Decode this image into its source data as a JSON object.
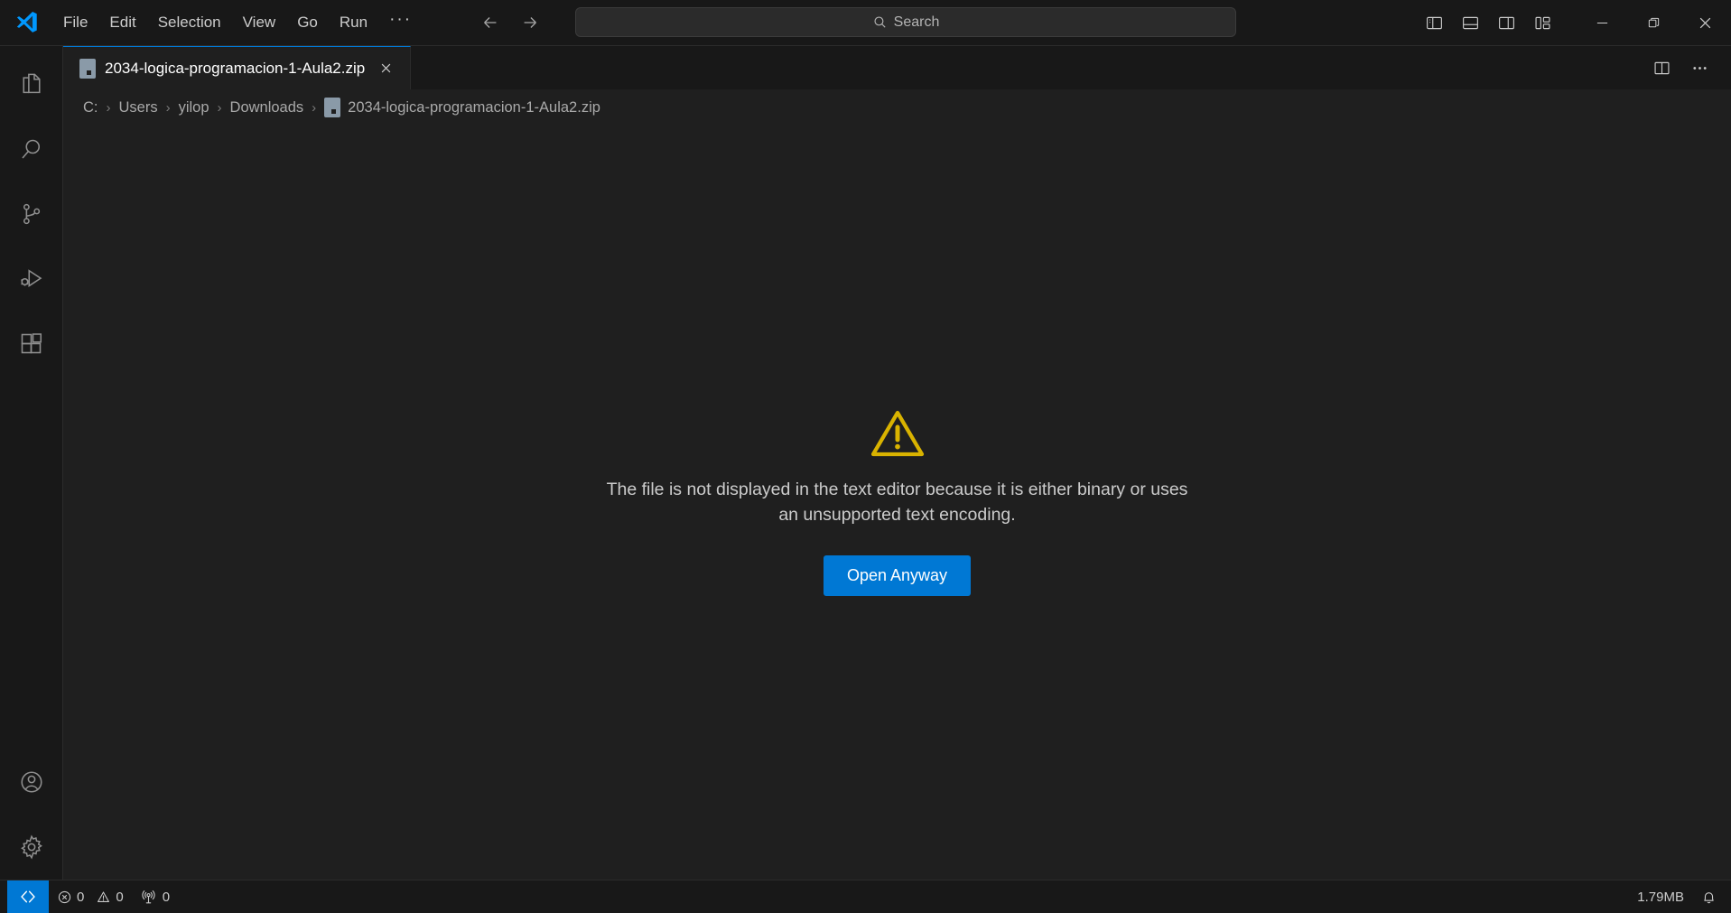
{
  "window": {
    "app_logo": "vscode-logo",
    "menus": [
      {
        "label": "File"
      },
      {
        "label": "Edit"
      },
      {
        "label": "Selection"
      },
      {
        "label": "View"
      },
      {
        "label": "Go"
      },
      {
        "label": "Run"
      }
    ],
    "menu_overflow_label": "···",
    "nav": {
      "back_icon": "arrow-left-icon",
      "forward_icon": "arrow-right-icon"
    },
    "search": {
      "placeholder": "Search",
      "value": "",
      "icon": "search-icon"
    },
    "layout_buttons": [
      {
        "name": "toggle-primary-sidebar",
        "icon": "layout-sidebar-left-icon"
      },
      {
        "name": "toggle-panel",
        "icon": "layout-panel-icon"
      },
      {
        "name": "toggle-secondary-sidebar",
        "icon": "layout-sidebar-right-icon"
      },
      {
        "name": "customize-layout",
        "icon": "layout-customize-icon"
      }
    ],
    "controls": [
      {
        "name": "minimize-button",
        "icon": "minimize-icon"
      },
      {
        "name": "maximize-button",
        "icon": "restore-icon"
      },
      {
        "name": "close-button",
        "icon": "close-icon"
      }
    ]
  },
  "activity_bar": {
    "top_items": [
      {
        "name": "explorer",
        "icon": "files-icon",
        "title": "Explorer"
      },
      {
        "name": "search",
        "icon": "search-icon",
        "title": "Search"
      },
      {
        "name": "source-control",
        "icon": "source-control-icon",
        "title": "Source Control"
      },
      {
        "name": "run-debug",
        "icon": "run-and-debug-icon",
        "title": "Run and Debug"
      },
      {
        "name": "extensions",
        "icon": "extensions-icon",
        "title": "Extensions"
      }
    ],
    "bottom_items": [
      {
        "name": "accounts",
        "icon": "account-icon",
        "title": "Accounts"
      },
      {
        "name": "settings",
        "icon": "gear-icon",
        "title": "Manage"
      }
    ]
  },
  "editor": {
    "tabs": [
      {
        "label": "2034-logica-programacion-1-Aula2.zip",
        "icon": "binary-file-icon",
        "active": true,
        "close_icon": "close-icon"
      }
    ],
    "actions": [
      {
        "name": "split-editor-right",
        "icon": "split-editor-icon"
      },
      {
        "name": "more-actions",
        "label": "···"
      }
    ],
    "breadcrumb": {
      "separator": "›",
      "items": [
        {
          "label": "C:",
          "icon": null
        },
        {
          "label": "Users",
          "icon": null
        },
        {
          "label": "yilop",
          "icon": null
        },
        {
          "label": "Downloads",
          "icon": null
        },
        {
          "label": "2034-logica-programacion-1-Aula2.zip",
          "icon": "binary-file-icon"
        }
      ]
    },
    "binary_notice": {
      "icon": "warning-triangle-icon",
      "message": "The file is not displayed in the text editor because it is either binary or uses an unsupported text encoding.",
      "button_label": "Open Anyway"
    }
  },
  "status_bar": {
    "remote": {
      "label": "",
      "icon": "remote-icon"
    },
    "problems": {
      "errors_icon": "error-icon",
      "errors": "0",
      "warnings_icon": "warning-icon",
      "warnings": "0"
    },
    "ports": {
      "icon": "radio-tower-icon",
      "count": "0"
    },
    "file_size": "1.79MB",
    "notifications": {
      "icon": "bell-icon"
    }
  },
  "colors": {
    "accent_blue": "#0078d4",
    "titlebar_bg": "#181818",
    "editor_bg": "#1f1f1f",
    "warning_yellow": "#d9b300",
    "text_primary": "#cccccc"
  }
}
